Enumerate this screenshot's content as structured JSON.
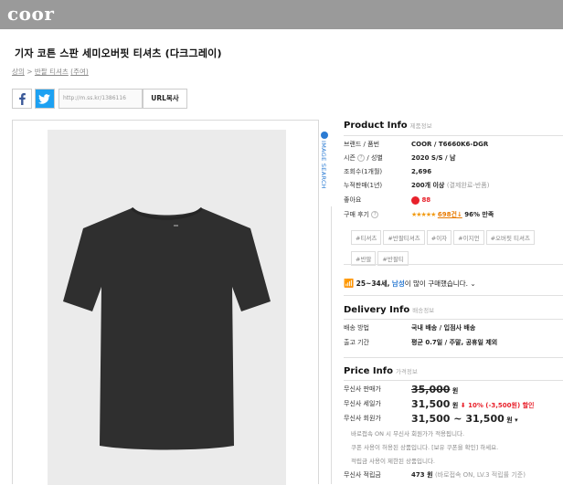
{
  "header": {
    "logo": "coor"
  },
  "product": {
    "title": "기자 코튼 스판 세미오버핏 티셔츠 (다크그레이)"
  },
  "breadcrumb": {
    "cat1": "상의",
    "sep": ">",
    "cat2": "반팔 티셔츠",
    "code": "(주여)"
  },
  "share": {
    "url": "http://m.ss.kr/1386116",
    "url_button": "URL복사"
  },
  "image_search": {
    "label": "IMAGE SEARCH"
  },
  "info": {
    "heading": "Product Info",
    "heading_sub": "제품정보",
    "brand_label": "브랜드 / 품번",
    "brand_value": "COOR / T6660K6-DGR",
    "season_label": "시즌",
    "gender_label": "성별",
    "season_value": "2020 S/S / 남",
    "views_label": "조회수(1개월)",
    "views_value": "2,696",
    "sales_label": "누적판매(1년)",
    "sales_value": "200개 이상",
    "sales_note": "(결제완료-반품)",
    "likes_label": "좋아요",
    "likes_value": "88",
    "review_label": "구매 후기",
    "review_stars": "★★★★★",
    "review_count": "698건",
    "review_satisfaction": "96% 만족",
    "tags": [
      "#티셔츠",
      "#반팔티셔츠",
      "#이자",
      "#이지언",
      "#오버핏 티셔츠",
      "#반팔",
      "#반팔티"
    ],
    "demo_text_a": "25~34세,",
    "demo_text_b": "남성",
    "demo_text_c": "이 많이 구매했습니다."
  },
  "delivery": {
    "heading": "Delivery Info",
    "heading_sub": "배송정보",
    "method_label": "배송 방법",
    "method_value": "국내 배송 / 입점사 배송",
    "ship_label": "출고 기간",
    "ship_value": "평균 0.7일 / 주말, 공휴일 제외"
  },
  "price": {
    "heading": "Price Info",
    "heading_sub": "가격정보",
    "list_label": "무신사 판매가",
    "list_value": "35,000",
    "won": "원",
    "sale_label": "무신사 세일가",
    "sale_value": "31,500",
    "sale_discount": "10% (-3,500원) 할인",
    "member_label": "무신사 회원가",
    "member_value": "31,500 ~ 31,500",
    "notes": [
      "바로접속 ON 시 무신사 회원가가 적용됩니다.",
      "쿠폰 사용이 허용된 상품입니다. [보유 쿠폰을 확인] 하세요.",
      "적립금 사용이 제한된 상품입니다."
    ],
    "points_label": "무신사 적립금",
    "points_value": "473",
    "points_note": "(바로접속 ON, LV.3 적립률 기준)"
  },
  "colors": {
    "accent_blue": "#2b7bd3",
    "sale_red": "#e8212b",
    "topbar": "#9a9a9a"
  }
}
